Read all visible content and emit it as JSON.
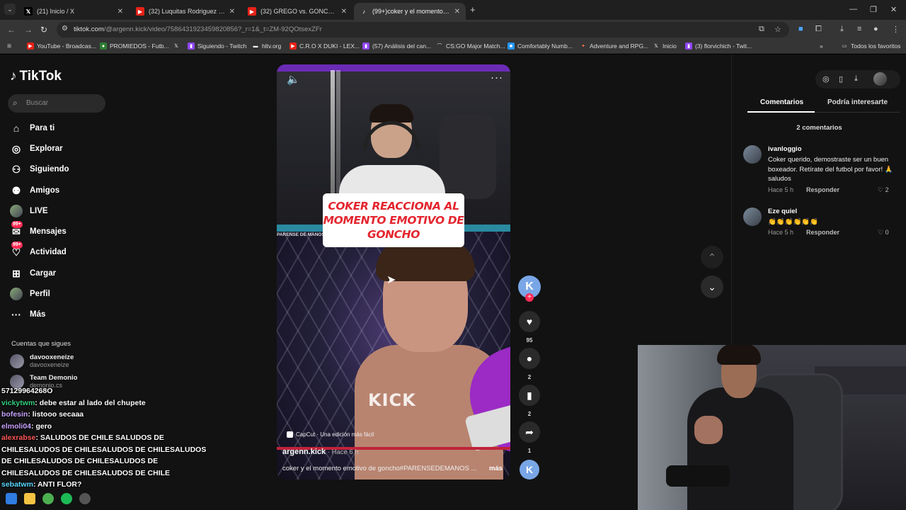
{
  "browser": {
    "tabs": [
      {
        "title": "(21) Inicio / X",
        "favicon": "x-icon",
        "active": false
      },
      {
        "title": "(32) Luquitas Rodriguez - YouTube",
        "favicon": "youtube-icon",
        "active": false
      },
      {
        "title": "(32) GREGO vs. GONCHO | PAR",
        "favicon": "youtube-icon",
        "active": false
      },
      {
        "title": "(99+)coker y el momento emot",
        "favicon": "tiktok-icon",
        "active": true
      }
    ],
    "url_host": "tiktok.com",
    "url_path": "/@argenn.kick/video/7586431923459820856?_r=1&_t=ZM-92QOtsexZFr",
    "bookmarks": [
      "YouTube - Broadcas...",
      "PROMIEDOS - Futb...",
      "",
      "Siguiendo - Twitch",
      "hltv.org",
      "C.R.O X DUKI - LEX...",
      "(57) Análisis del can...",
      "CS:GO Major Match...",
      "Comfortably Numb...",
      "Adventure and RPG...",
      "Inicio",
      "(3) florvichich - Twit..."
    ],
    "bookmarks_all": "Todos los favoritos"
  },
  "sidebar": {
    "logo": "TikTok",
    "search_placeholder": "Buscar",
    "nav": [
      {
        "label": "Para ti",
        "icon": "home-icon"
      },
      {
        "label": "Explorar",
        "icon": "compass-icon"
      },
      {
        "label": "Siguiendo",
        "icon": "following-icon"
      },
      {
        "label": "Amigos",
        "icon": "friends-icon"
      },
      {
        "label": "LIVE",
        "icon": "live-icon"
      },
      {
        "label": "Mensajes",
        "icon": "messages-icon",
        "badge": "99+"
      },
      {
        "label": "Actividad",
        "icon": "activity-icon",
        "badge": "99+"
      },
      {
        "label": "Cargar",
        "icon": "upload-icon"
      },
      {
        "label": "Perfil",
        "icon": "profile-icon"
      },
      {
        "label": "Más",
        "icon": "more-icon"
      }
    ],
    "following_title": "Cuentas que sigues",
    "following": [
      {
        "name": "davooxeneize",
        "handle": "davooxeneize"
      },
      {
        "name": "Team Demonio",
        "handle": "demonio.cs"
      }
    ]
  },
  "video": {
    "caption_overlay": "COKER REACCIONA AL MOMENTO EMOTIVO DE GONCHO",
    "side_label": "PARENSE DE MANOS",
    "brand": "KICK",
    "capcut": "CapCut · Una edición más fácil",
    "author": "argenn.kick",
    "posted": " · Hace 6 h",
    "description": "coker y el momento emotivo de goncho#PARENSEDEMANOS ...",
    "more": "más"
  },
  "actions": {
    "likes": "95",
    "comments": "2",
    "saves": "2",
    "shares": "1"
  },
  "comments_panel": {
    "tab_comments": "Comentarios",
    "tab_interest": "Podría interesarte",
    "count_label": "2 comentarios",
    "comments": [
      {
        "user": "ivanloggio",
        "text": "Coker querido, demostraste ser un buen boxeador. Retírate del futbol por favor! 🙏 saludos",
        "time": "Hace 5 h",
        "reply": "Responder",
        "likes": "2"
      },
      {
        "user": "Eze quiel",
        "text": "👏👏👏👏👏👏",
        "time": "Hace 5 h",
        "reply": "Responder",
        "likes": "0"
      }
    ]
  },
  "chat": [
    {
      "user": "",
      "text": "57129964268O"
    },
    {
      "user": "vickytwm",
      "text": ": debe estar al lado del chupete"
    },
    {
      "user": "bofesin",
      "text": ": listooo secaaa"
    },
    {
      "user": "elmoli04",
      "text": ": gero"
    },
    {
      "user": "alexrabse",
      "text": ": SALUDOS DE CHILE SALUDOS DE CHILESALUDOS DE CHILESALUDOS DE CHILESALUDOS DE CHILESALUDOS DE CHILESALUDOS DE CHILESALUDOS DE CHILESALUDOS DE CHILE"
    },
    {
      "user": "sebatwm",
      "text": ": ANTI FLOR?"
    }
  ]
}
